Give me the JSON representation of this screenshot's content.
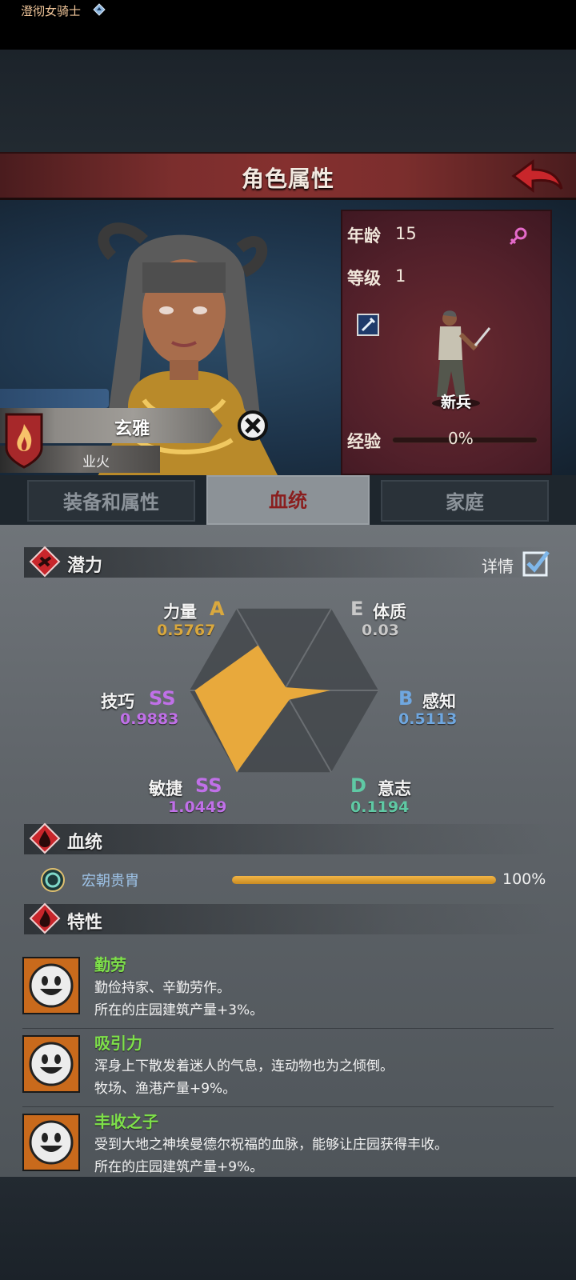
{
  "header": {
    "title": "角色属性"
  },
  "character": {
    "title": "澄彻女骑士",
    "name": "玄雅",
    "element": "业火"
  },
  "info": {
    "age_label": "年龄",
    "age": "15",
    "level_label": "等级",
    "level": "1",
    "class": "新兵",
    "exp_label": "经验",
    "exp": "0%"
  },
  "tabs": [
    "装备和属性",
    "血统",
    "家庭"
  ],
  "active_tab": "血统",
  "potential": {
    "section_title": "潜力",
    "detail_label": "详情",
    "stats": [
      {
        "name": "力量",
        "grade": "A",
        "value": "0.5767",
        "color": "#d9a83e"
      },
      {
        "name": "体质",
        "grade": "E",
        "value": "0.03",
        "color": "#c8c8c8"
      },
      {
        "name": "感知",
        "grade": "B",
        "value": "0.5113",
        "color": "#6fa7e0"
      },
      {
        "name": "意志",
        "grade": "D",
        "value": "0.1194",
        "color": "#5fc9a4"
      },
      {
        "name": "敏捷",
        "grade": "SS",
        "value": "1.0449",
        "color": "#c070e8"
      },
      {
        "name": "技巧",
        "grade": "SS",
        "value": "0.9883",
        "color": "#c070e8"
      }
    ]
  },
  "bloodline": {
    "section_title": "血统",
    "name": "宏朝贵胄",
    "percent": "100%",
    "fill": 1.0
  },
  "traits": {
    "section_title": "特性",
    "items": [
      {
        "name": "勤劳",
        "desc": "勤俭持家、辛勤劳作。",
        "effect": "所在的庄园建筑产量+3%。"
      },
      {
        "name": "吸引力",
        "desc": "浑身上下散发着迷人的气息，连动物也为之倾倒。",
        "effect": "牧场、渔港产量+9%。"
      },
      {
        "name": "丰收之子",
        "desc": "受到大地之神埃曼德尔祝福的血脉，能够让庄园获得丰收。",
        "effect": "所在的庄园建筑产量+9%。"
      }
    ]
  },
  "colors": {
    "accent_red": "#8a1e1e",
    "radar_fill": "#e8a93c",
    "trait_green": "#7ee04a"
  }
}
